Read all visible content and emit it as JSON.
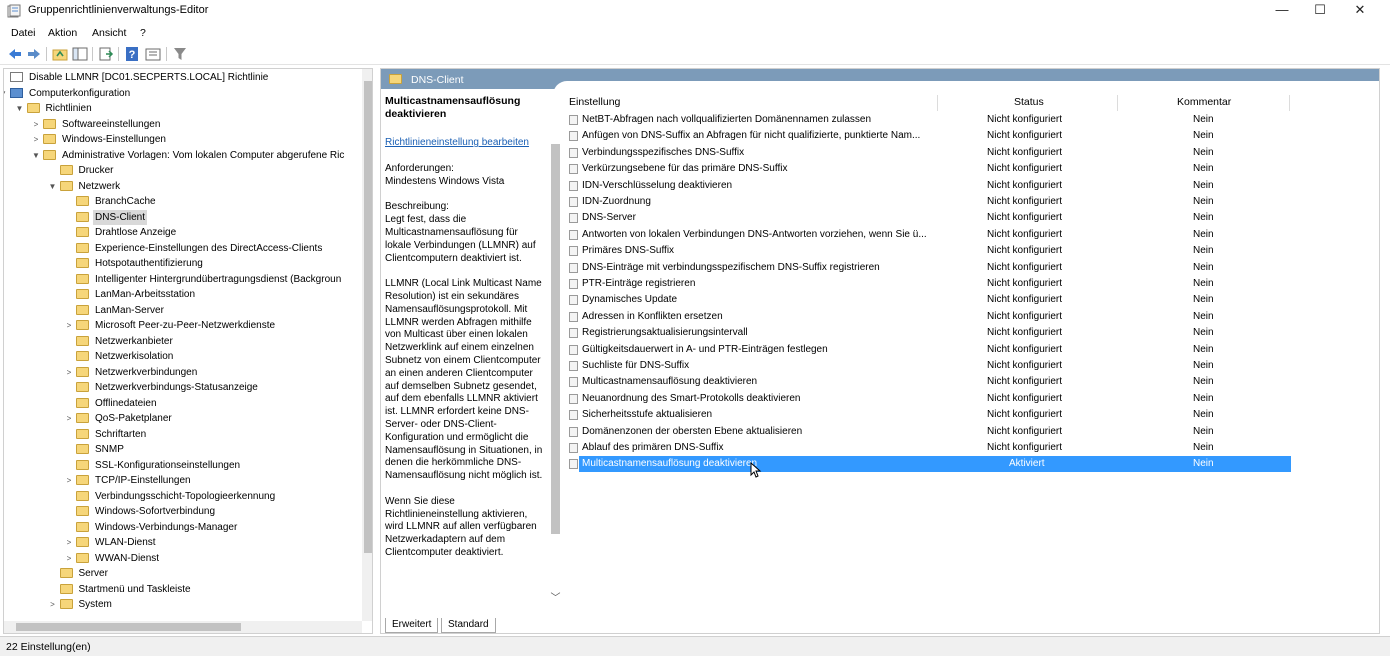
{
  "window": {
    "title": "Gruppenrichtlinienverwaltungs-Editor",
    "minimize": "—",
    "maximize": "☐",
    "close": "✕"
  },
  "menu": [
    "Datei",
    "Aktion",
    "Ansicht",
    "?"
  ],
  "toolbar": [
    "back-icon",
    "forward-icon",
    "up-folder-icon",
    "show-hide-tree-icon",
    "export-list-icon",
    "help-icon",
    "properties-icon",
    "filter-icon"
  ],
  "tree": [
    {
      "label": "Disable LLMNR [DC01.SECPERTS.LOCAL] Richtlinie",
      "icon": "policy-icon",
      "expander": ""
    },
    {
      "label": "Computerkonfiguration",
      "icon": "computer-icon",
      "expander": "▼"
    },
    {
      "label": "Richtlinien",
      "icon": "folder-icon",
      "expander": "▼"
    },
    {
      "label": "Softwareeinstellungen",
      "icon": "folder-icon",
      "expander": ">"
    },
    {
      "label": "Windows-Einstellungen",
      "icon": "folder-icon",
      "expander": ">"
    },
    {
      "label": "Administrative Vorlagen: Vom lokalen Computer abgerufene Ric",
      "icon": "folder-icon",
      "expander": "▼"
    },
    {
      "label": "Drucker",
      "icon": "folder-icon",
      "expander": ""
    },
    {
      "label": "Netzwerk",
      "icon": "folder-icon",
      "expander": "▼"
    },
    {
      "label": "BranchCache",
      "icon": "folder-icon",
      "expander": ""
    },
    {
      "label": "DNS-Client",
      "icon": "folder-icon",
      "expander": "",
      "selected": true
    },
    {
      "label": "Drahtlose Anzeige",
      "icon": "folder-icon",
      "expander": ""
    },
    {
      "label": "Experience-Einstellungen des DirectAccess-Clients",
      "icon": "folder-icon",
      "expander": ""
    },
    {
      "label": "Hotspotauthentifizierung",
      "icon": "folder-icon",
      "expander": ""
    },
    {
      "label": "Intelligenter Hintergrundübertragungsdienst (Backgroun",
      "icon": "folder-icon",
      "expander": ""
    },
    {
      "label": "LanMan-Arbeitsstation",
      "icon": "folder-icon",
      "expander": ""
    },
    {
      "label": "LanMan-Server",
      "icon": "folder-icon",
      "expander": ""
    },
    {
      "label": "Microsoft Peer-zu-Peer-Netzwerkdienste",
      "icon": "folder-icon",
      "expander": ">"
    },
    {
      "label": "Netzwerkanbieter",
      "icon": "folder-icon",
      "expander": ""
    },
    {
      "label": "Netzwerkisolation",
      "icon": "folder-icon",
      "expander": ""
    },
    {
      "label": "Netzwerkverbindungen",
      "icon": "folder-icon",
      "expander": ">"
    },
    {
      "label": "Netzwerkverbindungs-Statusanzeige",
      "icon": "folder-icon",
      "expander": ""
    },
    {
      "label": "Offlinedateien",
      "icon": "folder-icon",
      "expander": ""
    },
    {
      "label": "QoS-Paketplaner",
      "icon": "folder-icon",
      "expander": ">"
    },
    {
      "label": "Schriftarten",
      "icon": "folder-icon",
      "expander": ""
    },
    {
      "label": "SNMP",
      "icon": "folder-icon",
      "expander": ""
    },
    {
      "label": "SSL-Konfigurationseinstellungen",
      "icon": "folder-icon",
      "expander": ""
    },
    {
      "label": "TCP/IP-Einstellungen",
      "icon": "folder-icon",
      "expander": ">"
    },
    {
      "label": "Verbindungsschicht-Topologieerkennung",
      "icon": "folder-icon",
      "expander": ""
    },
    {
      "label": "Windows-Sofortverbindung",
      "icon": "folder-icon",
      "expander": ""
    },
    {
      "label": "Windows-Verbindungs-Manager",
      "icon": "folder-icon",
      "expander": ""
    },
    {
      "label": "WLAN-Dienst",
      "icon": "folder-icon",
      "expander": ">"
    },
    {
      "label": "WWAN-Dienst",
      "icon": "folder-icon",
      "expander": ">"
    },
    {
      "label": "Server",
      "icon": "folder-icon",
      "expander": ""
    },
    {
      "label": "Startmenü und Taskleiste",
      "icon": "folder-icon",
      "expander": ""
    },
    {
      "label": "System",
      "icon": "folder-icon",
      "expander": ">"
    }
  ],
  "pane": {
    "header": "DNS-Client",
    "description_title": "Multicastnamensauflösung deaktivieren",
    "edit_link": "Richtlinieneinstellung bearbeiten",
    "description_body": "Anforderungen:\nMindestens Windows Vista\n\nBeschreibung:\nLegt fest, dass die Multicastnamensauflösung für lokale Verbindungen (LLMNR) auf Clientcomputern deaktiviert ist.\n\nLLMNR (Local Link Multicast Name Resolution) ist ein sekundäres Namensauflösungsprotokoll. Mit LLMNR werden Abfragen mithilfe von Multicast über einen lokalen Netzwerklink auf einem einzelnen Subnetz von einem Clientcomputer  an einen anderen Clientcomputer auf demselben Subnetz gesendet, auf dem ebenfalls LLMNR aktiviert ist. LLMNR erfordert keine DNS-Server- oder DNS-Client-Konfiguration und ermöglicht die Namensauflösung in Situationen, in denen die herkömmliche DNS-Namensauflösung nicht möglich ist.\n\nWenn Sie diese Richtlinieneinstellung aktivieren, wird LLMNR auf allen verfügbaren Netzwerkadaptern auf dem Clientcomputer deaktiviert."
  },
  "table": {
    "columns": [
      "Einstellung",
      "Status",
      "Kommentar"
    ],
    "rows": [
      {
        "name": "NetBT-Abfragen nach vollqualifizierten Domänennamen zulassen",
        "status": "Nicht konfiguriert",
        "comment": "Nein"
      },
      {
        "name": "Anfügen von DNS-Suffix an Abfragen für nicht qualifizierte, punktierte Nam...",
        "status": "Nicht konfiguriert",
        "comment": "Nein"
      },
      {
        "name": "Verbindungsspezifisches DNS-Suffix",
        "status": "Nicht konfiguriert",
        "comment": "Nein"
      },
      {
        "name": "Verkürzungsebene für das primäre DNS-Suffix",
        "status": "Nicht konfiguriert",
        "comment": "Nein"
      },
      {
        "name": "IDN-Verschlüsselung deaktivieren",
        "status": "Nicht konfiguriert",
        "comment": "Nein"
      },
      {
        "name": "IDN-Zuordnung",
        "status": "Nicht konfiguriert",
        "comment": "Nein"
      },
      {
        "name": "DNS-Server",
        "status": "Nicht konfiguriert",
        "comment": "Nein"
      },
      {
        "name": "Antworten von lokalen Verbindungen DNS-Antworten vorziehen, wenn Sie ü...",
        "status": "Nicht konfiguriert",
        "comment": "Nein"
      },
      {
        "name": "Primäres DNS-Suffix",
        "status": "Nicht konfiguriert",
        "comment": "Nein"
      },
      {
        "name": "DNS-Einträge mit verbindungsspezifischem DNS-Suffix registrieren",
        "status": "Nicht konfiguriert",
        "comment": "Nein"
      },
      {
        "name": "PTR-Einträge registrieren",
        "status": "Nicht konfiguriert",
        "comment": "Nein"
      },
      {
        "name": "Dynamisches Update",
        "status": "Nicht konfiguriert",
        "comment": "Nein"
      },
      {
        "name": "Adressen in Konflikten ersetzen",
        "status": "Nicht konfiguriert",
        "comment": "Nein"
      },
      {
        "name": "Registrierungsaktualisierungsintervall",
        "status": "Nicht konfiguriert",
        "comment": "Nein"
      },
      {
        "name": "Gültigkeitsdauerwert in A- und PTR-Einträgen festlegen",
        "status": "Nicht konfiguriert",
        "comment": "Nein"
      },
      {
        "name": "Suchliste für DNS-Suffix",
        "status": "Nicht konfiguriert",
        "comment": "Nein"
      },
      {
        "name": "Multicastnamensauflösung deaktivieren",
        "status": "Nicht konfiguriert",
        "comment": "Nein"
      },
      {
        "name": "Neuanordnung des Smart-Protokolls deaktivieren",
        "status": "Nicht konfiguriert",
        "comment": "Nein"
      },
      {
        "name": "Sicherheitsstufe aktualisieren",
        "status": "Nicht konfiguriert",
        "comment": "Nein"
      },
      {
        "name": "Domänenzonen der obersten Ebene aktualisieren",
        "status": "Nicht konfiguriert",
        "comment": "Nein"
      },
      {
        "name": "Ablauf des primären DNS-Suffix",
        "status": "Nicht konfiguriert",
        "comment": "Nein"
      },
      {
        "name": "Multicastnamensauflösung deaktivieren",
        "status": "Aktiviert",
        "comment": "Nein",
        "selected": true
      }
    ]
  },
  "tabs": [
    "Erweitert",
    "Standard"
  ],
  "status_bar": "22 Einstellung(en)",
  "colors": {
    "pane_header": "#7c9bb9",
    "selection": "#3399ff",
    "link": "#1a5fb4",
    "folder": "#f6d67a"
  }
}
